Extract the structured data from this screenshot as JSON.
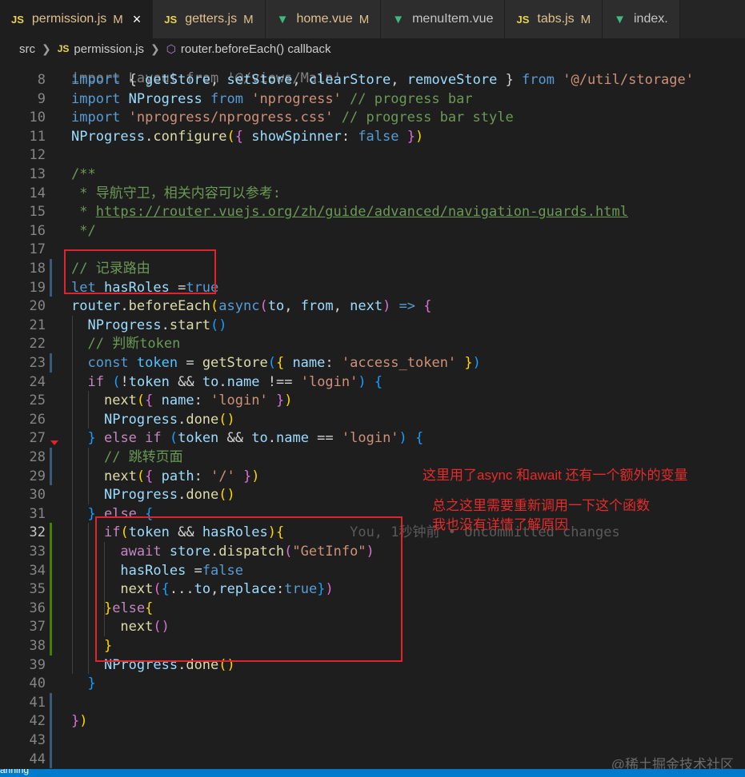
{
  "tabs": [
    {
      "label": "permission.js",
      "mark": "M",
      "type": "js",
      "active": true,
      "close": "×"
    },
    {
      "label": "getters.js",
      "mark": "M",
      "type": "js",
      "active": false
    },
    {
      "label": "home.vue",
      "mark": "M",
      "type": "vue",
      "active": false
    },
    {
      "label": "menuItem.vue",
      "mark": "",
      "type": "vue",
      "active": false
    },
    {
      "label": "tabs.js",
      "mark": "M",
      "type": "js",
      "active": false
    },
    {
      "label": "index.",
      "mark": "",
      "type": "vue",
      "active": false
    }
  ],
  "breadcrumb": {
    "root": "src",
    "file": "permission.js",
    "symbol": "router.beforeEach() callback",
    "js_badge": "JS"
  },
  "lines": [
    {
      "n": "8",
      "code": [
        [
          "kw",
          "import "
        ],
        [
          "pun",
          "{ "
        ],
        [
          "id",
          "getStore"
        ],
        [
          "pun",
          ", "
        ],
        [
          "id",
          "setStore"
        ],
        [
          "pun",
          ", "
        ],
        [
          "id",
          "clearStore"
        ],
        [
          "pun",
          ", "
        ],
        [
          "id",
          "removeStore"
        ],
        [
          "pun",
          " } "
        ],
        [
          "kw",
          "from "
        ],
        [
          "str",
          "'@/util/storage'"
        ]
      ]
    },
    {
      "n": "9",
      "code": [
        [
          "kw",
          "import "
        ],
        [
          "id",
          "NProgress "
        ],
        [
          "kw",
          "from "
        ],
        [
          "str",
          "'nprogress' "
        ],
        [
          "cm",
          "// progress bar"
        ]
      ]
    },
    {
      "n": "10",
      "code": [
        [
          "kw",
          "import "
        ],
        [
          "str",
          "'nprogress/nprogress.css' "
        ],
        [
          "cm",
          "// progress bar style"
        ]
      ]
    },
    {
      "n": "11",
      "code": [
        [
          "id",
          "NProgress"
        ],
        [
          "pun",
          "."
        ],
        [
          "fn",
          "configure"
        ],
        [
          "br1",
          "("
        ],
        [
          "br2",
          "{ "
        ],
        [
          "id",
          "showSpinner"
        ],
        [
          "pun",
          ": "
        ],
        [
          "kw",
          "false "
        ],
        [
          "br2",
          "}"
        ],
        [
          "br1",
          ")"
        ]
      ]
    },
    {
      "n": "12",
      "code": []
    },
    {
      "n": "13",
      "code": [
        [
          "cm",
          "/**"
        ]
      ]
    },
    {
      "n": "14",
      "code": [
        [
          "cm",
          " * 导航守卫，相关内容可以参考:"
        ]
      ]
    },
    {
      "n": "15",
      "code": [
        [
          "cm",
          " * "
        ],
        [
          "url",
          "https://router.vuejs.org/zh/guide/advanced/navigation-guards.html"
        ]
      ]
    },
    {
      "n": "16",
      "code": [
        [
          "cm",
          " */"
        ]
      ]
    },
    {
      "n": "17",
      "code": []
    },
    {
      "n": "18",
      "code": [
        [
          "cm",
          "// 记录路由"
        ]
      ]
    },
    {
      "n": "19",
      "code": [
        [
          "kw",
          "let "
        ],
        [
          "id",
          "hasRoles "
        ],
        [
          "op",
          "="
        ],
        [
          "kw",
          "true"
        ]
      ]
    },
    {
      "n": "20",
      "code": [
        [
          "id",
          "router"
        ],
        [
          "pun",
          "."
        ],
        [
          "fn",
          "beforeEach"
        ],
        [
          "br1",
          "("
        ],
        [
          "kw",
          "async"
        ],
        [
          "br2",
          "("
        ],
        [
          "id",
          "to"
        ],
        [
          "pun",
          ", "
        ],
        [
          "id",
          "from"
        ],
        [
          "pun",
          ", "
        ],
        [
          "id",
          "next"
        ],
        [
          "br2",
          ")"
        ],
        [
          "kw",
          " => "
        ],
        [
          "br2",
          "{"
        ]
      ]
    },
    {
      "n": "21",
      "code": [
        [
          "pun",
          "  "
        ],
        [
          "id",
          "NProgress"
        ],
        [
          "pun",
          "."
        ],
        [
          "fn",
          "start"
        ],
        [
          "br3",
          "()"
        ]
      ]
    },
    {
      "n": "22",
      "code": [
        [
          "pun",
          "  "
        ],
        [
          "cm",
          "// 判断token"
        ]
      ]
    },
    {
      "n": "23",
      "code": [
        [
          "pun",
          "  "
        ],
        [
          "kw",
          "const "
        ],
        [
          "con",
          "token "
        ],
        [
          "op",
          "= "
        ],
        [
          "fn",
          "getStore"
        ],
        [
          "br3",
          "("
        ],
        [
          "br1",
          "{ "
        ],
        [
          "id",
          "name"
        ],
        [
          "pun",
          ": "
        ],
        [
          "str",
          "'access_token' "
        ],
        [
          "br1",
          "}"
        ],
        [
          "br3",
          ")"
        ]
      ]
    },
    {
      "n": "24",
      "code": [
        [
          "pun",
          "  "
        ],
        [
          "ctl",
          "if "
        ],
        [
          "br3",
          "("
        ],
        [
          "op",
          "!"
        ],
        [
          "id",
          "token "
        ],
        [
          "op",
          "&& "
        ],
        [
          "id",
          "to"
        ],
        [
          "pun",
          "."
        ],
        [
          "id",
          "name "
        ],
        [
          "op",
          "!== "
        ],
        [
          "str",
          "'login'"
        ],
        [
          "br3",
          ") "
        ],
        [
          "br3",
          "{"
        ]
      ]
    },
    {
      "n": "25",
      "code": [
        [
          "pun",
          "    "
        ],
        [
          "fn",
          "next"
        ],
        [
          "br1",
          "("
        ],
        [
          "br2",
          "{ "
        ],
        [
          "id",
          "name"
        ],
        [
          "pun",
          ": "
        ],
        [
          "str",
          "'login' "
        ],
        [
          "br2",
          "}"
        ],
        [
          "br1",
          ")"
        ]
      ]
    },
    {
      "n": "26",
      "code": [
        [
          "pun",
          "    "
        ],
        [
          "id",
          "NProgress"
        ],
        [
          "pun",
          "."
        ],
        [
          "fn",
          "done"
        ],
        [
          "br1",
          "()"
        ]
      ]
    },
    {
      "n": "27",
      "code": [
        [
          "pun",
          "  "
        ],
        [
          "br3",
          "} "
        ],
        [
          "ctl",
          "else if "
        ],
        [
          "br3",
          "("
        ],
        [
          "id",
          "token "
        ],
        [
          "op",
          "&& "
        ],
        [
          "id",
          "to"
        ],
        [
          "pun",
          "."
        ],
        [
          "id",
          "name "
        ],
        [
          "op",
          "== "
        ],
        [
          "str",
          "'login'"
        ],
        [
          "br3",
          ") "
        ],
        [
          "br3",
          "{"
        ]
      ]
    },
    {
      "n": "28",
      "code": [
        [
          "pun",
          "    "
        ],
        [
          "cm",
          "// 跳转页面"
        ]
      ]
    },
    {
      "n": "29",
      "code": [
        [
          "pun",
          "    "
        ],
        [
          "fn",
          "next"
        ],
        [
          "br1",
          "("
        ],
        [
          "br2",
          "{ "
        ],
        [
          "id",
          "path"
        ],
        [
          "pun",
          ": "
        ],
        [
          "str",
          "'/' "
        ],
        [
          "br2",
          "}"
        ],
        [
          "br1",
          ")"
        ]
      ]
    },
    {
      "n": "30",
      "code": [
        [
          "pun",
          "    "
        ],
        [
          "id",
          "NProgress"
        ],
        [
          "pun",
          "."
        ],
        [
          "fn",
          "done"
        ],
        [
          "br1",
          "()"
        ]
      ]
    },
    {
      "n": "31",
      "code": [
        [
          "pun",
          "  "
        ],
        [
          "br3",
          "} "
        ],
        [
          "ctl",
          "else "
        ],
        [
          "br3",
          "{"
        ]
      ]
    },
    {
      "n": "32",
      "code": [
        [
          "pun",
          "    "
        ],
        [
          "ctl",
          "if"
        ],
        [
          "br1",
          "("
        ],
        [
          "id",
          "token "
        ],
        [
          "op",
          "&& "
        ],
        [
          "id",
          "hasRoles"
        ],
        [
          "br1",
          ")"
        ],
        [
          "br1",
          "{"
        ],
        [
          "cmt-blame",
          "        You, 1秒钟前 • Uncommitted changes"
        ]
      ]
    },
    {
      "n": "33",
      "code": [
        [
          "pun",
          "      "
        ],
        [
          "ctl",
          "await "
        ],
        [
          "id",
          "store"
        ],
        [
          "pun",
          "."
        ],
        [
          "fn",
          "dispatch"
        ],
        [
          "br2",
          "("
        ],
        [
          "str",
          "\"GetInfo\""
        ],
        [
          "br2",
          ")"
        ]
      ]
    },
    {
      "n": "34",
      "code": [
        [
          "pun",
          "      "
        ],
        [
          "id",
          "hasRoles "
        ],
        [
          "op",
          "="
        ],
        [
          "kw",
          "false"
        ]
      ]
    },
    {
      "n": "35",
      "code": [
        [
          "pun",
          "      "
        ],
        [
          "fn",
          "next"
        ],
        [
          "br2",
          "("
        ],
        [
          "br3",
          "{"
        ],
        [
          "op",
          "..."
        ],
        [
          "id",
          "to"
        ],
        [
          "pun",
          ","
        ],
        [
          "id",
          "replace"
        ],
        [
          "pun",
          ":"
        ],
        [
          "kw",
          "true"
        ],
        [
          "br3",
          "}"
        ],
        [
          "br2",
          ")"
        ]
      ]
    },
    {
      "n": "36",
      "code": [
        [
          "pun",
          "    "
        ],
        [
          "br1",
          "}"
        ],
        [
          "ctl",
          "else"
        ],
        [
          "br1",
          "{"
        ]
      ]
    },
    {
      "n": "37",
      "code": [
        [
          "pun",
          "      "
        ],
        [
          "fn",
          "next"
        ],
        [
          "br2",
          "()"
        ]
      ]
    },
    {
      "n": "38",
      "code": [
        [
          "pun",
          "    "
        ],
        [
          "br1",
          "}"
        ]
      ]
    },
    {
      "n": "39",
      "code": [
        [
          "pun",
          "    "
        ],
        [
          "id",
          "NProgress"
        ],
        [
          "pun",
          "."
        ],
        [
          "fn",
          "done"
        ],
        [
          "br1",
          "()"
        ]
      ]
    },
    {
      "n": "40",
      "code": [
        [
          "pun",
          "  "
        ],
        [
          "br3",
          "}"
        ]
      ]
    },
    {
      "n": "41",
      "code": []
    },
    {
      "n": "42",
      "code": [
        [
          "br2",
          "}"
        ],
        [
          "br1",
          ")"
        ]
      ]
    },
    {
      "n": "43",
      "code": []
    },
    {
      "n": "44",
      "code": []
    }
  ],
  "partial_top_line": "import Layout from '@/views/Main'",
  "notes": {
    "line1": "这里用了async 和await  还有一个额外的变量",
    "line2": "总之这里需要重新调用一下这个函数",
    "line3": "我也没有详情了解原因"
  },
  "status_text": "anning",
  "watermark": "@稀土掘金技术社区",
  "colors": {
    "editor_bg": "#1e1e1e",
    "annotation_red": "#e0232c",
    "status_blue": "#007acc"
  }
}
